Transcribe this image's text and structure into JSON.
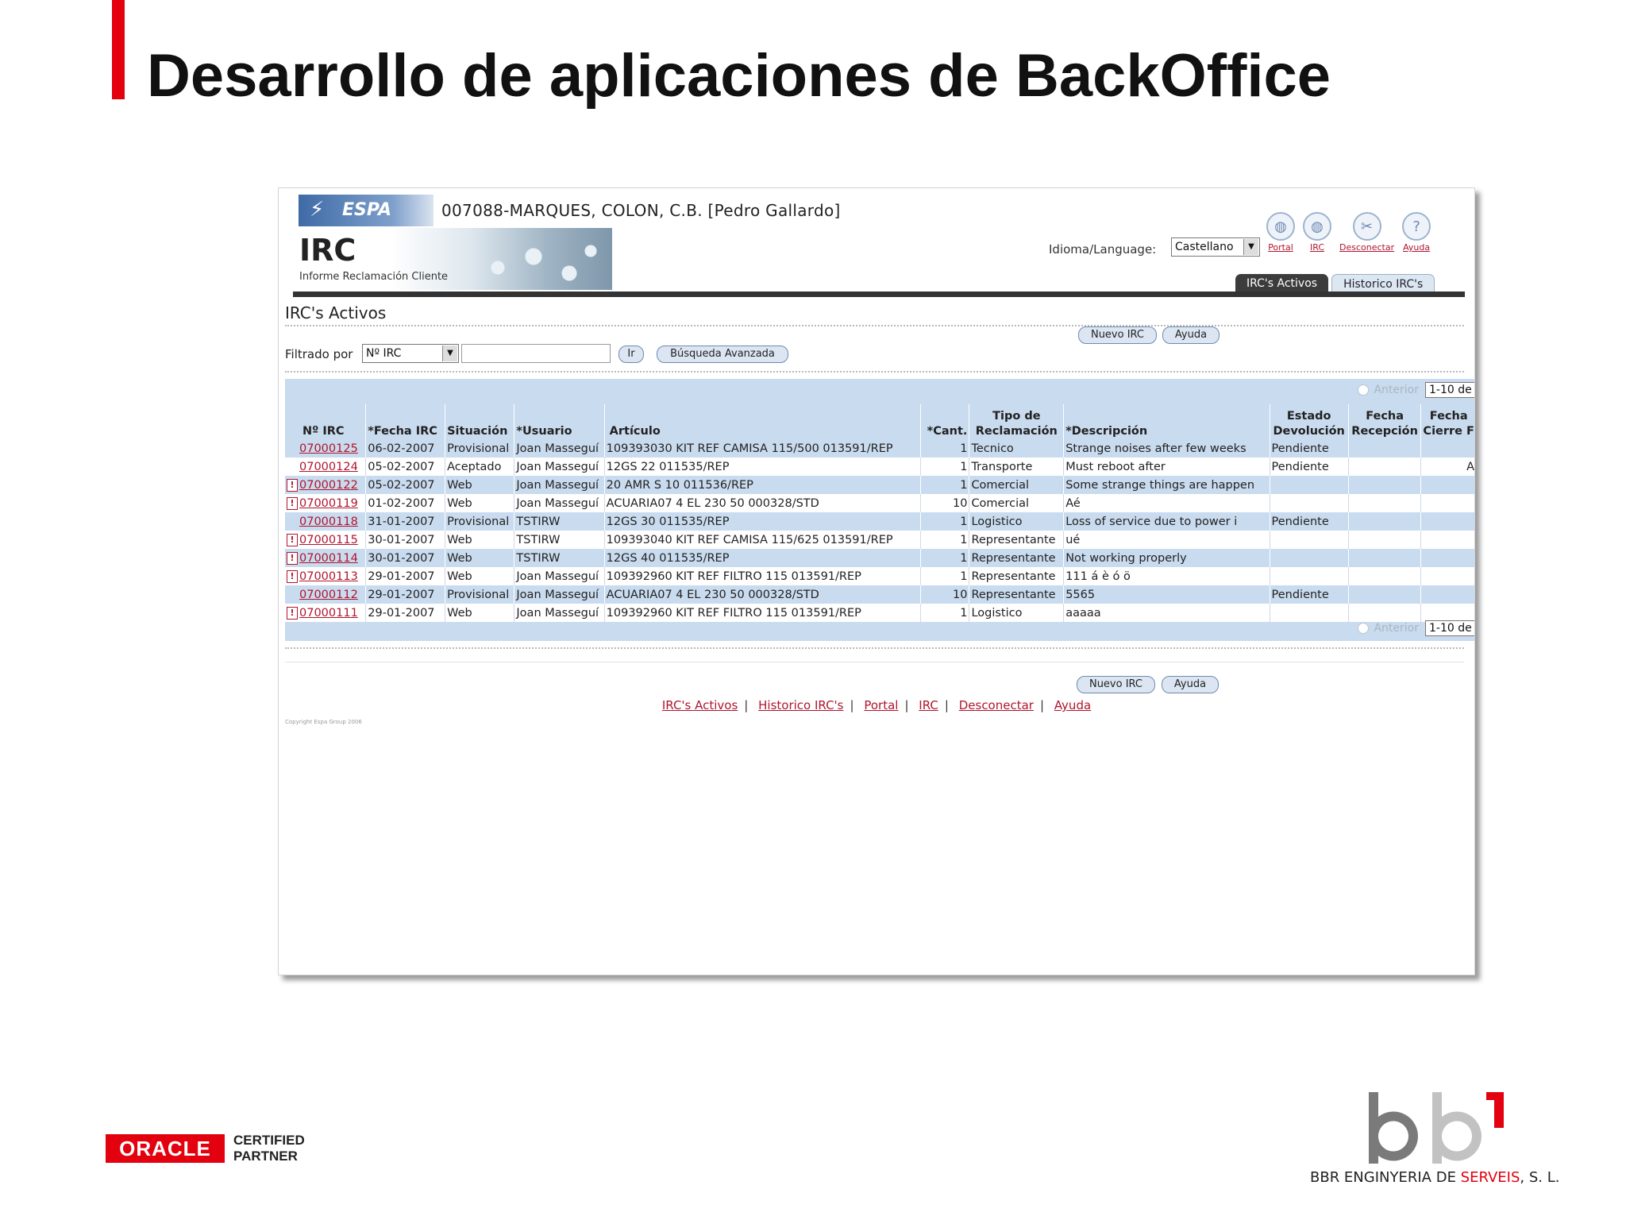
{
  "slide": {
    "title": "Desarrollo de aplicaciones de BackOffice"
  },
  "app": {
    "brand": "ESPA",
    "company": "007088-MARQUES, COLON, C.B. [Pedro Gallardo]",
    "product": "IRC",
    "product_subtitle": "Informe Reclamación Cliente",
    "language_label": "Idioma/Language:",
    "language_value": "Castellano",
    "top_icons": [
      {
        "label": "Portal",
        "icon": "portal-icon"
      },
      {
        "label": "IRC",
        "icon": "irc-icon"
      },
      {
        "label": "Desconectar",
        "icon": "disconnect-icon"
      },
      {
        "label": "Ayuda",
        "icon": "help-icon"
      }
    ],
    "tabs": [
      {
        "label": "IRC's Activos",
        "active": true
      },
      {
        "label": "Historico IRC's",
        "active": false
      }
    ],
    "page_heading": "IRC's Activos",
    "buttons": {
      "new": "Nuevo IRC",
      "help": "Ayuda",
      "go": "Ir",
      "advanced": "Búsqueda Avanzada"
    },
    "filter": {
      "label": "Filtrado por",
      "field": "Nº IRC",
      "value": ""
    },
    "pager": {
      "previous": "Anterior",
      "range": "1-10 de"
    },
    "columns": [
      "Nº IRC",
      "*Fecha IRC",
      "Situación",
      "*Usuario",
      "Artículo",
      "*Cant.",
      "Tipo de Reclamación",
      "*Descripción",
      "Estado Devolución",
      "Fecha Recepción",
      "Fecha Cierre F"
    ],
    "column_lines": [
      [
        "",
        "Nº IRC"
      ],
      [
        "",
        "*Fecha IRC"
      ],
      [
        "",
        "Situación"
      ],
      [
        "",
        "*Usuario"
      ],
      [
        "",
        "Artículo"
      ],
      [
        "",
        "*Cant."
      ],
      [
        "Tipo de",
        "Reclamación"
      ],
      [
        "",
        "*Descripción"
      ],
      [
        "Estado",
        "Devolución"
      ],
      [
        "Fecha",
        "Recepción"
      ],
      [
        "Fecha",
        "Cierre F"
      ]
    ],
    "rows": [
      {
        "flag": false,
        "id": "07000125",
        "date": "06-02-2007",
        "status": "Provisional",
        "user": "Joan Masseguí",
        "article": "109393030 KIT REF CAMISA 115/500 013591/REP",
        "qty": "1",
        "type": "Tecnico",
        "desc": "Strange noises after few weeks",
        "ret": "Pendiente",
        "rec": "",
        "close": ""
      },
      {
        "flag": false,
        "id": "07000124",
        "date": "05-02-2007",
        "status": "Aceptado",
        "user": "Joan Masseguí",
        "article": "12GS 22 011535/REP",
        "qty": "1",
        "type": "Transporte",
        "desc": "Must reboot after",
        "ret": "Pendiente",
        "rec": "",
        "close": "A"
      },
      {
        "flag": true,
        "id": "07000122",
        "date": "05-02-2007",
        "status": "Web",
        "user": "Joan Masseguí",
        "article": "20 AMR S 10 011536/REP",
        "qty": "1",
        "type": "Comercial",
        "desc": "Some strange things are happen",
        "ret": "",
        "rec": "",
        "close": ""
      },
      {
        "flag": true,
        "id": "07000119",
        "date": "01-02-2007",
        "status": "Web",
        "user": "Joan Masseguí",
        "article": "ACUARIA07 4 EL 230 50 000328/STD",
        "qty": "10",
        "type": "Comercial",
        "desc": "Aé",
        "ret": "",
        "rec": "",
        "close": ""
      },
      {
        "flag": false,
        "id": "07000118",
        "date": "31-01-2007",
        "status": "Provisional",
        "user": "TSTIRW",
        "article": "12GS 30 011535/REP",
        "qty": "1",
        "type": "Logistico",
        "desc": "Loss of service due to power i",
        "ret": "Pendiente",
        "rec": "",
        "close": ""
      },
      {
        "flag": true,
        "id": "07000115",
        "date": "30-01-2007",
        "status": "Web",
        "user": "TSTIRW",
        "article": "109393040 KIT REF CAMISA 115/625 013591/REP",
        "qty": "1",
        "type": "Representante",
        "desc": "ué",
        "ret": "",
        "rec": "",
        "close": ""
      },
      {
        "flag": true,
        "id": "07000114",
        "date": "30-01-2007",
        "status": "Web",
        "user": "TSTIRW",
        "article": "12GS 40 011535/REP",
        "qty": "1",
        "type": "Representante",
        "desc": "Not working properly",
        "ret": "",
        "rec": "",
        "close": ""
      },
      {
        "flag": true,
        "id": "07000113",
        "date": "29-01-2007",
        "status": "Web",
        "user": "Joan Masseguí",
        "article": "109392960 KIT REF FILTRO 115 013591/REP",
        "qty": "1",
        "type": "Representante",
        "desc": "111 á è ó ö",
        "ret": "",
        "rec": "",
        "close": ""
      },
      {
        "flag": false,
        "id": "07000112",
        "date": "29-01-2007",
        "status": "Provisional",
        "user": "Joan Masseguí",
        "article": "ACUARIA07 4 EL 230 50 000328/STD",
        "qty": "10",
        "type": "Representante",
        "desc": "5565",
        "ret": "Pendiente",
        "rec": "",
        "close": ""
      },
      {
        "flag": true,
        "id": "07000111",
        "date": "29-01-2007",
        "status": "Web",
        "user": "Joan Masseguí",
        "article": "109392960 KIT REF FILTRO 115 013591/REP",
        "qty": "1",
        "type": "Logistico",
        "desc": "aaaaa",
        "ret": "",
        "rec": "",
        "close": ""
      }
    ],
    "footer_links": [
      "IRC's Activos",
      "Historico IRC's",
      "Portal",
      "IRC",
      "Desconectar",
      "Ayuda"
    ],
    "copyright": "Copyright Espa Group 2006"
  },
  "logos": {
    "oracle": "ORACLE",
    "oracle_cert_1": "CERTIFIED",
    "oracle_cert_2": "PARTNER",
    "bbr_prefix": "BBR ENGINYERIA DE ",
    "bbr_red": "SERVEIS",
    "bbr_suffix": ", S. L."
  },
  "colors": {
    "accent_red": "#e3000f",
    "link_red": "#b0152e",
    "grid_blue": "#c9dbee"
  }
}
